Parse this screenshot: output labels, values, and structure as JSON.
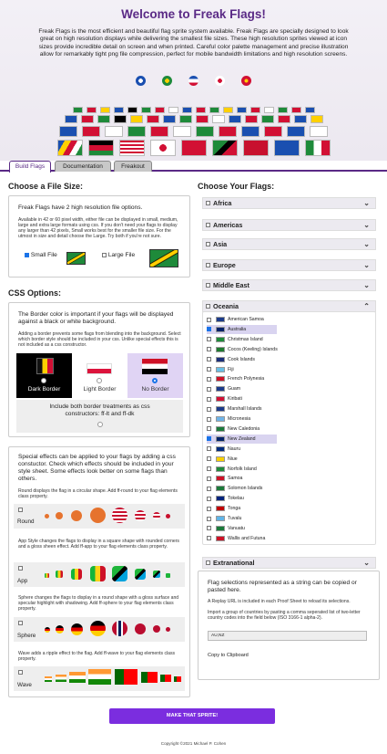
{
  "hero": {
    "title": "Welcome to Freak Flags!",
    "intro": "Freak Flags is the most efficient and beautiful flag sprite system available. Freak Flags are specially designed to look great on high resolution displays while delivering the smallest file sizes. These high resolution sprites viewed at icon sizes provide incredible detail on screen and when printed. Careful color palette management and precise illustration allow for remarkably tight png file compression, perfect for mobile bandwidth limitations and high resolution screens."
  },
  "tabs": [
    "Build Flags",
    "Documentation",
    "Freakout"
  ],
  "file": {
    "heading": "Choose a File Size:",
    "lead": "Freak Flags have 2 high resolution file options.",
    "desc": "Available in 42 or 60 pixel width, either file can be displayed in small, medium, large and extra large formats using css. If you don't need your flags to display any larger than 42 pixels, Small works best for the smaller file size. For the utmost in size and detail choose the Large. Try both if you're not sure.",
    "small": "Small File",
    "large": "Large File"
  },
  "css": {
    "heading": "CSS Options:",
    "lead": "The Border color is important if your flags will be displayed against a black or white background.",
    "desc": "Adding a border prevents some flags from blending into the background. Select which border style should be included in your css. Unlike special effects this is not included as a css constructor.",
    "dark": "Dark Border",
    "light": "Light Border",
    "none": "No Border",
    "both": "Include both border treatments as css constructors: ff-lt and ff-dk"
  },
  "effects": {
    "lead": "Special effects can be applied to your flags by adding a css constuctor. Check which effects should be included in your style sheet. Some effects look better on some flags than others.",
    "round_desc": "Round displays the flag in a circular shape. Add ff-round to your flag elements class property.",
    "round": "Round",
    "app_desc": "App Style changes the flags to display in a square shape with rounded corners and a gloss sheen effect. Add ff-app to your flag elements class property.",
    "app": "App",
    "sphere_desc": "Sphere changes the flags to display in a round shape with a gloss surface and specular highlight with shadowing. Add ff-sphere to your flag elements class property.",
    "sphere": "Sphere",
    "wave_desc": "Wave adds a ripple effect to the flag. Add ff-wave to your flag elements class property.",
    "wave": "Wave"
  },
  "flags": {
    "heading": "Choose Your Flags:",
    "regions": [
      "Africa",
      "Americas",
      "Asia",
      "Europe",
      "Middle East",
      "Oceania",
      "Extranational"
    ],
    "oceania": [
      {
        "n": "American Samoa",
        "c": "#1b3a8a"
      },
      {
        "n": "Australia",
        "c": "#012169",
        "on": true
      },
      {
        "n": "Christmas Island",
        "c": "#1f8a3a"
      },
      {
        "n": "Cocos (Keeling) Islands",
        "c": "#1f7a30"
      },
      {
        "n": "Cook Islands",
        "c": "#1b2f7a"
      },
      {
        "n": "Fiji",
        "c": "#68bfe5"
      },
      {
        "n": "French Polynesia",
        "c": "#ce1126"
      },
      {
        "n": "Guam",
        "c": "#1b3a8a"
      },
      {
        "n": "Kiribati",
        "c": "#d21034"
      },
      {
        "n": "Marshall Islands",
        "c": "#1b3a8a"
      },
      {
        "n": "Micronesia",
        "c": "#6fb4e8"
      },
      {
        "n": "New Caledonia",
        "c": "#1b7a3a"
      },
      {
        "n": "New Zealand",
        "c": "#012169",
        "on": true
      },
      {
        "n": "Nauru",
        "c": "#002b7f"
      },
      {
        "n": "Niue",
        "c": "#f8d000"
      },
      {
        "n": "Norfolk Island",
        "c": "#1f8a3a"
      },
      {
        "n": "Samoa",
        "c": "#ce1126"
      },
      {
        "n": "Solomon Islands",
        "c": "#1b7a3a"
      },
      {
        "n": "Tokelau",
        "c": "#00247d"
      },
      {
        "n": "Tonga",
        "c": "#c10000"
      },
      {
        "n": "Tuvalu",
        "c": "#5fb4e8"
      },
      {
        "n": "Vanuatu",
        "c": "#1b7a3a"
      },
      {
        "n": "Wallis and Futuna",
        "c": "#ce1126"
      }
    ]
  },
  "export": {
    "lead": "Flag selections represented as a string can be copied or pasted here.",
    "replay": "A Replay URL is included in each Proof Sheet to reload its selections.",
    "import": "Import a group of countries by pasting a comma seperated list of two-letter country codes into the field below (ISO 3166-1 alpha-2).",
    "value": "AU,NZ",
    "copy": "Copy to Clipboard"
  },
  "make": "MAKE THAT SPRITE!",
  "copyright": "Copyright ©2021 Michael P. Cohen"
}
